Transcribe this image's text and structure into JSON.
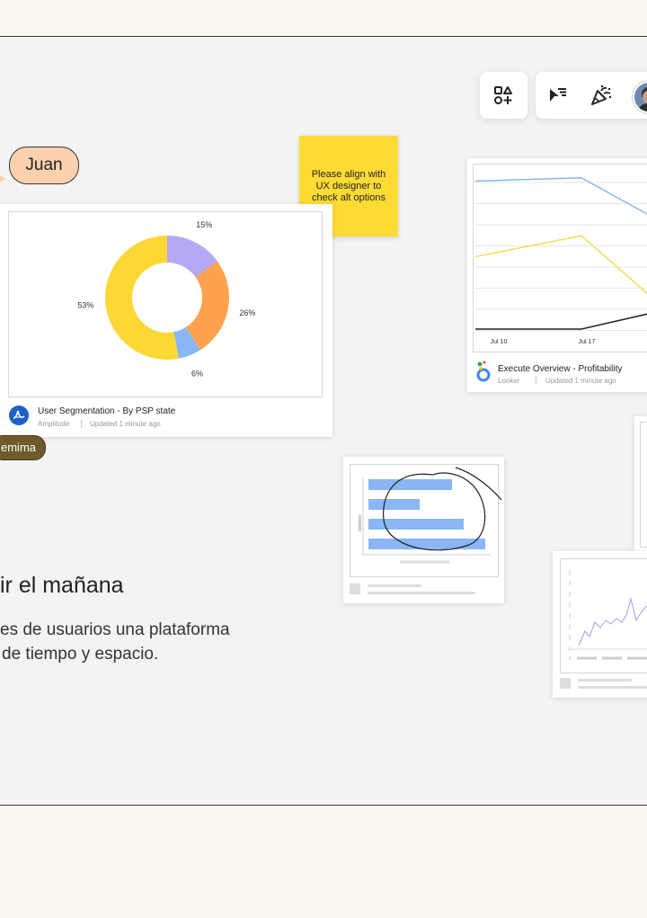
{
  "toolbar": {
    "items": [
      {
        "icon": "shapes-add-icon"
      },
      {
        "icon": "cursor-select-icon"
      },
      {
        "icon": "party-popper-icon"
      },
      {
        "icon": "avatar"
      }
    ]
  },
  "cursor": {
    "name": "Juan"
  },
  "sticky_note": {
    "text": "Please align with UX designer to check alt options"
  },
  "donut_card": {
    "title": "User Segmentation - By PSP state",
    "source": "Amplitude",
    "updated": "Updated 1 minute ago",
    "chart_data": {
      "type": "pie",
      "title": "",
      "slices": [
        {
          "label": "15%",
          "value": 15,
          "color": "#b6a8f5"
        },
        {
          "label": "26%",
          "value": 26,
          "color": "#ffa24e"
        },
        {
          "label": "6%",
          "value": 6,
          "color": "#8ab6f5"
        },
        {
          "label": "53%",
          "value": 53,
          "color": "#fdd835"
        }
      ]
    }
  },
  "line_card": {
    "title": "Execute Overview - Profitability",
    "source": "Looker",
    "updated": "Updated 1 minute ago",
    "chart_data": {
      "type": "line",
      "title": "",
      "xlabel": "",
      "ylabel": "",
      "x_ticks": [
        "Jul 10",
        "Jul 17"
      ],
      "grid": true,
      "series": [
        {
          "color": "#8ab6e8",
          "values": [
            92,
            94,
            65
          ]
        },
        {
          "color": "#f5dd50",
          "values": [
            45,
            58,
            12
          ]
        },
        {
          "color": "#222222",
          "values": [
            0,
            0,
            12
          ]
        }
      ]
    }
  },
  "collaborator_pill": {
    "text": "emima"
  },
  "hero": {
    "heading": "ir el mañana",
    "line1": "es de usuarios una plataforma",
    "line2": "de tiempo y espacio."
  },
  "colors": {
    "sticky": "#fddb34",
    "cursor_tag": "#fcd2ae",
    "pill": "#6e5a2c"
  }
}
